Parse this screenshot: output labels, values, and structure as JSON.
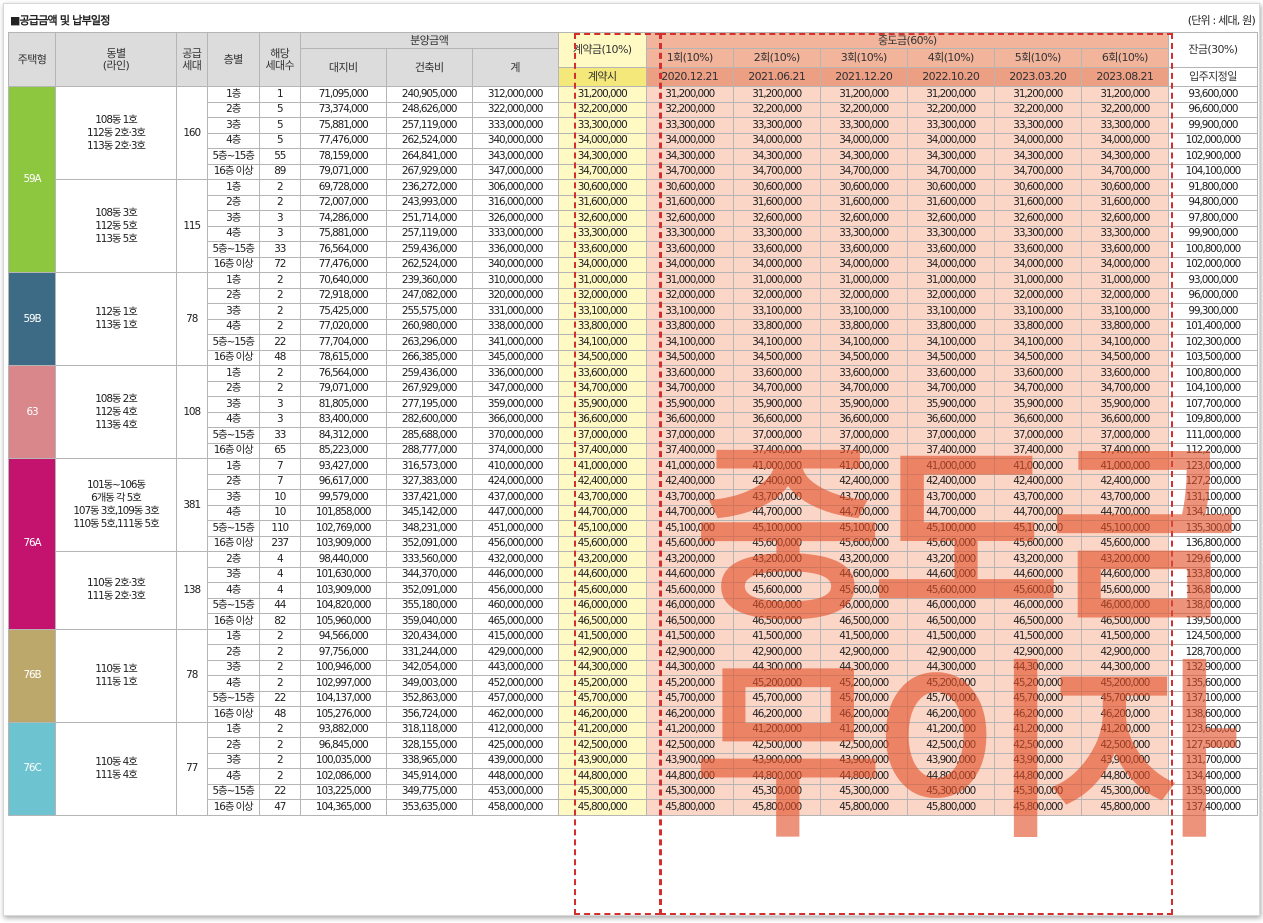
{
  "title": "■공급금액 및 납부일정",
  "unit": "(단위 : 세대, 원)",
  "watermark": [
    "중도금",
    "무이자"
  ],
  "colors": {
    "59A": "#8dc63f",
    "59B": "#3d6b85",
    "63": "#d9878b",
    "76A": "#c4126f",
    "76B": "#bda86b",
    "76C": "#6dc3cf"
  },
  "headers": {
    "type": "주택형",
    "dong": "동별\n(라인)",
    "supply": "공급\n세대",
    "floor": "층별",
    "count": "해당\n세대수",
    "price": "분양금액",
    "land": "대지비",
    "build": "건축비",
    "total": "계",
    "contract": "계약금(10%)",
    "contract_when": "계약시",
    "middle": "중도금(60%)",
    "middle_items": [
      {
        "label": "1회(10%)",
        "date": "2020.12.21"
      },
      {
        "label": "2회(10%)",
        "date": "2021.06.21"
      },
      {
        "label": "3회(10%)",
        "date": "2021.12.20"
      },
      {
        "label": "4회(10%)",
        "date": "2022.10.20"
      },
      {
        "label": "5회(10%)",
        "date": "2023.03.20"
      },
      {
        "label": "6회(10%)",
        "date": "2023.08.21"
      }
    ],
    "balance": "잔금(30%)",
    "balance_when": "입주지정일"
  },
  "groups": [
    {
      "type": "59A",
      "color": "#8dc63f",
      "blocks": [
        {
          "dong": "108동 1호\n112동 2호·3호\n113동 2호·3호",
          "supply": "160",
          "rows": [
            [
              "1층",
              "1",
              "71,095,000",
              "240,905,000",
              "312,000,000",
              "31,200,000",
              "93,600,000"
            ],
            [
              "2층",
              "5",
              "73,374,000",
              "248,626,000",
              "322,000,000",
              "32,200,000",
              "96,600,000"
            ],
            [
              "3층",
              "5",
              "75,881,000",
              "257,119,000",
              "333,000,000",
              "33,300,000",
              "99,900,000"
            ],
            [
              "4층",
              "5",
              "77,476,000",
              "262,524,000",
              "340,000,000",
              "34,000,000",
              "102,000,000"
            ],
            [
              "5층~15층",
              "55",
              "78,159,000",
              "264,841,000",
              "343,000,000",
              "34,300,000",
              "102,900,000"
            ],
            [
              "16층 이상",
              "89",
              "79,071,000",
              "267,929,000",
              "347,000,000",
              "34,700,000",
              "104,100,000"
            ]
          ]
        },
        {
          "dong": "108동 3호\n112동 5호\n113동 5호",
          "supply": "115",
          "rows": [
            [
              "1층",
              "2",
              "69,728,000",
              "236,272,000",
              "306,000,000",
              "30,600,000",
              "91,800,000"
            ],
            [
              "2층",
              "2",
              "72,007,000",
              "243,993,000",
              "316,000,000",
              "31,600,000",
              "94,800,000"
            ],
            [
              "3층",
              "3",
              "74,286,000",
              "251,714,000",
              "326,000,000",
              "32,600,000",
              "97,800,000"
            ],
            [
              "4층",
              "3",
              "75,881,000",
              "257,119,000",
              "333,000,000",
              "33,300,000",
              "99,900,000"
            ],
            [
              "5층~15층",
              "33",
              "76,564,000",
              "259,436,000",
              "336,000,000",
              "33,600,000",
              "100,800,000"
            ],
            [
              "16층 이상",
              "72",
              "77,476,000",
              "262,524,000",
              "340,000,000",
              "34,000,000",
              "102,000,000"
            ]
          ]
        }
      ]
    },
    {
      "type": "59B",
      "color": "#3d6b85",
      "blocks": [
        {
          "dong": "112동 1호\n113동 1호",
          "supply": "78",
          "rows": [
            [
              "1층",
              "2",
              "70,640,000",
              "239,360,000",
              "310,000,000",
              "31,000,000",
              "93,000,000"
            ],
            [
              "2층",
              "2",
              "72,918,000",
              "247,082,000",
              "320,000,000",
              "32,000,000",
              "96,000,000"
            ],
            [
              "3층",
              "2",
              "75,425,000",
              "255,575,000",
              "331,000,000",
              "33,100,000",
              "99,300,000"
            ],
            [
              "4층",
              "2",
              "77,020,000",
              "260,980,000",
              "338,000,000",
              "33,800,000",
              "101,400,000"
            ],
            [
              "5층~15층",
              "22",
              "77,704,000",
              "263,296,000",
              "341,000,000",
              "34,100,000",
              "102,300,000"
            ],
            [
              "16층 이상",
              "48",
              "78,615,000",
              "266,385,000",
              "345,000,000",
              "34,500,000",
              "103,500,000"
            ]
          ]
        }
      ]
    },
    {
      "type": "63",
      "color": "#d9878b",
      "blocks": [
        {
          "dong": "108동 2호\n112동 4호\n113동 4호",
          "supply": "108",
          "rows": [
            [
              "1층",
              "2",
              "76,564,000",
              "259,436,000",
              "336,000,000",
              "33,600,000",
              "100,800,000"
            ],
            [
              "2층",
              "2",
              "79,071,000",
              "267,929,000",
              "347,000,000",
              "34,700,000",
              "104,100,000"
            ],
            [
              "3층",
              "3",
              "81,805,000",
              "277,195,000",
              "359,000,000",
              "35,900,000",
              "107,700,000"
            ],
            [
              "4층",
              "3",
              "83,400,000",
              "282,600,000",
              "366,000,000",
              "36,600,000",
              "109,800,000"
            ],
            [
              "5층~15층",
              "33",
              "84,312,000",
              "285,688,000",
              "370,000,000",
              "37,000,000",
              "111,000,000"
            ],
            [
              "16층 이상",
              "65",
              "85,223,000",
              "288,777,000",
              "374,000,000",
              "37,400,000",
              "112,200,000"
            ]
          ]
        }
      ]
    },
    {
      "type": "76A",
      "color": "#c4126f",
      "blocks": [
        {
          "dong": "101동~106동\n6개동 각 5호\n107동 3호,109동 3호\n110동 5호,111동 5호",
          "supply": "381",
          "rows": [
            [
              "1층",
              "7",
              "93,427,000",
              "316,573,000",
              "410,000,000",
              "41,000,000",
              "123,000,000"
            ],
            [
              "2층",
              "7",
              "96,617,000",
              "327,383,000",
              "424,000,000",
              "42,400,000",
              "127,200,000"
            ],
            [
              "3층",
              "10",
              "99,579,000",
              "337,421,000",
              "437,000,000",
              "43,700,000",
              "131,100,000"
            ],
            [
              "4층",
              "10",
              "101,858,000",
              "345,142,000",
              "447,000,000",
              "44,700,000",
              "134,100,000"
            ],
            [
              "5층~15층",
              "110",
              "102,769,000",
              "348,231,000",
              "451,000,000",
              "45,100,000",
              "135,300,000"
            ],
            [
              "16층 이상",
              "237",
              "103,909,000",
              "352,091,000",
              "456,000,000",
              "45,600,000",
              "136,800,000"
            ]
          ]
        },
        {
          "dong": "110동 2호·3호\n111동 2호·3호",
          "supply": "138",
          "rows": [
            [
              "2층",
              "4",
              "98,440,000",
              "333,560,000",
              "432,000,000",
              "43,200,000",
              "129,600,000"
            ],
            [
              "3층",
              "4",
              "101,630,000",
              "344,370,000",
              "446,000,000",
              "44,600,000",
              "133,800,000"
            ],
            [
              "4층",
              "4",
              "103,909,000",
              "352,091,000",
              "456,000,000",
              "45,600,000",
              "136,800,000"
            ],
            [
              "5층~15층",
              "44",
              "104,820,000",
              "355,180,000",
              "460,000,000",
              "46,000,000",
              "138,000,000"
            ],
            [
              "16층 이상",
              "82",
              "105,960,000",
              "359,040,000",
              "465,000,000",
              "46,500,000",
              "139,500,000"
            ]
          ]
        }
      ]
    },
    {
      "type": "76B",
      "color": "#bda86b",
      "blocks": [
        {
          "dong": "110동 1호\n111동 1호",
          "supply": "78",
          "rows": [
            [
              "1층",
              "2",
              "94,566,000",
              "320,434,000",
              "415,000,000",
              "41,500,000",
              "124,500,000"
            ],
            [
              "2층",
              "2",
              "97,756,000",
              "331,244,000",
              "429,000,000",
              "42,900,000",
              "128,700,000"
            ],
            [
              "3층",
              "2",
              "100,946,000",
              "342,054,000",
              "443,000,000",
              "44,300,000",
              "132,900,000"
            ],
            [
              "4층",
              "2",
              "102,997,000",
              "349,003,000",
              "452,000,000",
              "45,200,000",
              "135,600,000"
            ],
            [
              "5층~15층",
              "22",
              "104,137,000",
              "352,863,000",
              "457,000,000",
              "45,700,000",
              "137,100,000"
            ],
            [
              "16층 이상",
              "48",
              "105,276,000",
              "356,724,000",
              "462,000,000",
              "46,200,000",
              "138,600,000"
            ]
          ]
        }
      ]
    },
    {
      "type": "76C",
      "color": "#6dc3cf",
      "blocks": [
        {
          "dong": "110동 4호\n111동 4호",
          "supply": "77",
          "rows": [
            [
              "1층",
              "2",
              "93,882,000",
              "318,118,000",
              "412,000,000",
              "41,200,000",
              "123,600,000"
            ],
            [
              "2층",
              "2",
              "96,845,000",
              "328,155,000",
              "425,000,000",
              "42,500,000",
              "127,500,000"
            ],
            [
              "3층",
              "2",
              "100,035,000",
              "338,965,000",
              "439,000,000",
              "43,900,000",
              "131,700,000"
            ],
            [
              "4층",
              "2",
              "102,086,000",
              "345,914,000",
              "448,000,000",
              "44,800,000",
              "134,400,000"
            ],
            [
              "5층~15층",
              "22",
              "103,225,000",
              "349,775,000",
              "453,000,000",
              "45,300,000",
              "135,900,000"
            ],
            [
              "16층 이상",
              "47",
              "104,365,000",
              "353,635,000",
              "458,000,000",
              "45,800,000",
              "137,400,000"
            ]
          ]
        }
      ]
    }
  ]
}
